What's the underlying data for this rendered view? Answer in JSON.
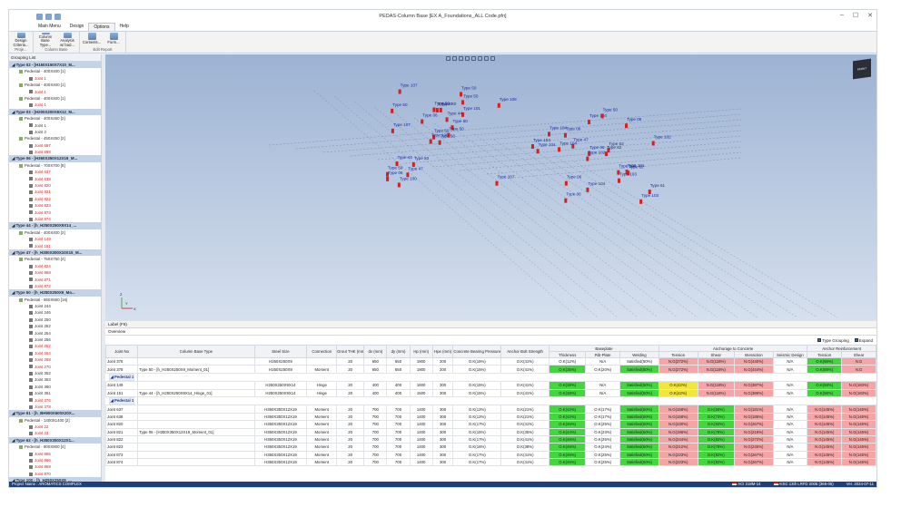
{
  "app": {
    "title": "PEDAS-Column Base [EX A_Foundations_ALL Code.pfn]"
  },
  "menu": {
    "items": [
      "Main Menu",
      "Design",
      "Options",
      "Help"
    ],
    "active": "Options"
  },
  "ribbon": {
    "groups": [
      {
        "label": "Proje...",
        "buttons": [
          "Design Criteria..."
        ]
      },
      {
        "label": "Column Base",
        "buttons": [
          "Column Base Type...",
          "Analysis w/ bad..."
        ]
      },
      {
        "label": "Edit Report",
        "buttons": [
          "Contents...",
          "Form..."
        ]
      }
    ]
  },
  "grouping": {
    "header": "Grouping List",
    "items": [
      {
        "kind": "type",
        "text": "Type 02 - [H150X150X7X10_M..."
      },
      {
        "kind": "ped",
        "text": "Pedestal - 400X400 [1]"
      },
      {
        "kind": "joint",
        "text": "Joint 1",
        "red": true
      },
      {
        "kind": "ped",
        "text": "Pedestal - 400X400 [1]"
      },
      {
        "kind": "joint",
        "text": "Joint 1",
        "red": true
      },
      {
        "kind": "ped",
        "text": "Pedestal - 400X400 [1]"
      },
      {
        "kind": "joint",
        "text": "Joint 1",
        "red": true
      },
      {
        "kind": "type",
        "text": "Type 03 - [H200X200X8X12_M..."
      },
      {
        "kind": "ped",
        "text": "Pedestal - 400X450 [2]"
      },
      {
        "kind": "joint",
        "text": "Joint 1",
        "red": false
      },
      {
        "kind": "joint",
        "text": "Joint 2",
        "red": false
      },
      {
        "kind": "ped",
        "text": "Pedestal - 450X450 [2]"
      },
      {
        "kind": "joint",
        "text": "Joint 697",
        "red": true
      },
      {
        "kind": "joint",
        "text": "Joint 698",
        "red": true
      },
      {
        "kind": "type",
        "text": "Type 06 - [H350X350X12X19_M..."
      },
      {
        "kind": "ped",
        "text": "Pedestal - 700X700 [8]"
      },
      {
        "kind": "joint",
        "text": "Joint 637",
        "red": true
      },
      {
        "kind": "joint",
        "text": "Joint 638",
        "red": true
      },
      {
        "kind": "joint",
        "text": "Joint 820",
        "red": true
      },
      {
        "kind": "joint",
        "text": "Joint 821",
        "red": true
      },
      {
        "kind": "joint",
        "text": "Joint 822",
        "red": true
      },
      {
        "kind": "joint",
        "text": "Joint 823",
        "red": true
      },
      {
        "kind": "joint",
        "text": "Joint 873",
        "red": true
      },
      {
        "kind": "joint",
        "text": "Joint 874",
        "red": true
      },
      {
        "kind": "type",
        "text": "Type 44 - [h_H250X250X9X14_..."
      },
      {
        "kind": "ped",
        "text": "Pedestal - 400X400 [2]"
      },
      {
        "kind": "joint",
        "text": "Joint 149",
        "red": true
      },
      {
        "kind": "joint",
        "text": "Joint 151",
        "red": true
      },
      {
        "kind": "type",
        "text": "Type 47 - [h_H300X300X10X15_M..."
      },
      {
        "kind": "ped",
        "text": "Pedestal - 750X750 [4]"
      },
      {
        "kind": "joint",
        "text": "Joint 824",
        "red": true
      },
      {
        "kind": "joint",
        "text": "Joint 868",
        "red": true
      },
      {
        "kind": "joint",
        "text": "Joint 871",
        "red": true
      },
      {
        "kind": "joint",
        "text": "Joint 872",
        "red": true
      },
      {
        "kind": "type",
        "text": "Type 50 - [h_H250X250X9_Mo..."
      },
      {
        "kind": "ped",
        "text": "Pedestal - 650X650 [16]"
      },
      {
        "kind": "joint",
        "text": "Joint 244",
        "red": false
      },
      {
        "kind": "joint",
        "text": "Joint 246",
        "red": false
      },
      {
        "kind": "joint",
        "text": "Joint 250",
        "red": false
      },
      {
        "kind": "joint",
        "text": "Joint 252",
        "red": false
      },
      {
        "kind": "joint",
        "text": "Joint 254",
        "red": false
      },
      {
        "kind": "joint",
        "text": "Joint 256",
        "red": false
      },
      {
        "kind": "joint",
        "text": "Joint 262",
        "red": true
      },
      {
        "kind": "joint",
        "text": "Joint 264",
        "red": true
      },
      {
        "kind": "joint",
        "text": "Joint 268",
        "red": true
      },
      {
        "kind": "joint",
        "text": "Joint 270",
        "red": true
      },
      {
        "kind": "joint",
        "text": "Joint 352",
        "red": false
      },
      {
        "kind": "joint",
        "text": "Joint 353",
        "red": false
      },
      {
        "kind": "joint",
        "text": "Joint 360",
        "red": false
      },
      {
        "kind": "joint",
        "text": "Joint 361",
        "red": false
      },
      {
        "kind": "joint",
        "text": "Joint 376",
        "red": true
      },
      {
        "kind": "joint",
        "text": "Joint 378",
        "red": true
      },
      {
        "kind": "type",
        "text": "Type 61 - [h_BH900X600X20X..."
      },
      {
        "kind": "ped",
        "text": "Pedestal - 1400X1400 [2]"
      },
      {
        "kind": "joint",
        "text": "Joint 22",
        "red": true
      },
      {
        "kind": "joint",
        "text": "Joint 23",
        "red": true
      },
      {
        "kind": "type",
        "text": "Type 62 - [h_H350X350X12X1..."
      },
      {
        "kind": "ped",
        "text": "Pedestal - 800X800 [4]"
      },
      {
        "kind": "joint",
        "text": "Joint 865",
        "red": true
      },
      {
        "kind": "joint",
        "text": "Joint 866",
        "red": true
      },
      {
        "kind": "joint",
        "text": "Joint 869",
        "red": true
      },
      {
        "kind": "joint",
        "text": "Joint 870",
        "red": true
      },
      {
        "kind": "type",
        "text": "Type 100 - [h_H250X250X9_..."
      }
    ]
  },
  "view3d": {
    "label_bar": "Label (F6)",
    "cube_text": "FRONT",
    "axis_x": "X",
    "axis_y": "Y",
    "axis_z": "Z",
    "labels": [
      "Type 50",
      "Type 50",
      "Type 50",
      "Type 50",
      "Type 50",
      "Type 50",
      "Type 50",
      "Type 50",
      "Type 50",
      "Type 50",
      "Type 107",
      "Type 107",
      "Type 107",
      "Type 108",
      "Type 100",
      "Type 101",
      "Type 100",
      "Type 50",
      "Type 44",
      "Type 44",
      "Type 06",
      "Type 06",
      "Type 47",
      "Type 47",
      "Type 62",
      "Type 62",
      "Type 104",
      "Type 104",
      "Type 104",
      "Type 103",
      "Type 102",
      "Type 102",
      "Type 104",
      "Type 06",
      "Type 06",
      "Type 06",
      "Type 06",
      "Type 103",
      "Type 61",
      "Type 101",
      "Type 50",
      "Type 47",
      "Type 104",
      "Type 103",
      "Type 06",
      "Type 104",
      "Type 62"
    ]
  },
  "overview": {
    "header": "Overview",
    "opt_type_grouping": "Type Grouping",
    "opt_expand": "Expand",
    "head_groups": [
      "Concrete Bearing Pressure",
      "Anchor Bolt Strength",
      "Baseplate",
      "Anchorage to Concrete",
      "Anchor Reinforcement"
    ],
    "columns": [
      "Joint No",
      "Column Base Type",
      "Steel Size",
      "Connection",
      "Grout THK (mm)",
      "dx (mm)",
      "dy (mm)",
      "Hp (mm)",
      "Hpe (mm)",
      "Concrete Bearing Pressure",
      "Anchor Bolt Strength",
      "Thickness",
      "Rib-Plate",
      "Welding",
      "Tension",
      "Shear",
      "Interaction",
      "Seismic Design",
      "Tension",
      "Shear"
    ],
    "rows": [
      {
        "g": false,
        "cells": [
          "Joint 376",
          "",
          "H250X250X9",
          "",
          "20",
          "650",
          "650",
          "1900",
          "200",
          "O.K(15%)",
          "O.K(41%)",
          "O.K(12%)",
          "N/A",
          "Satisfied(50%)",
          "N.G(272%)",
          "N.G(118%)",
          "N.G(440%)",
          "N/A",
          "O.K(88%)",
          "N.G"
        ],
        "cls": [
          "",
          "",
          "",
          "",
          "",
          "",
          "",
          "",
          "",
          "",
          "",
          "",
          "",
          "",
          "r",
          "r",
          "r",
          "",
          "g",
          "r"
        ]
      },
      {
        "g": false,
        "cells": [
          "Joint 378",
          "Type 50 - [h_H250X250X9_Moment_01]",
          "H250X250X9",
          "Moment",
          "20",
          "650",
          "650",
          "1900",
          "200",
          "O.K(15%)",
          "O.K(41%)",
          "O.K(35%)",
          "O.K(20%)",
          "Satisfied(50%)",
          "N.G(272%)",
          "N.G(118%)",
          "N.G(444%)",
          "N/A",
          "O.K(88%)",
          "N.G"
        ],
        "cls": [
          "",
          "",
          "",
          "",
          "",
          "",
          "",
          "",
          "",
          "",
          "",
          "g",
          "",
          "g",
          "r",
          "r",
          "r",
          "",
          "g",
          "r"
        ]
      },
      {
        "g": true,
        "cells": [
          "◢ Pedestal 18 [400 x 400 x 1600 ] [ 2 - EA ]"
        ]
      },
      {
        "g": false,
        "cells": [
          "Joint 149",
          "",
          "H250X250X9X14",
          "Hinge",
          "20",
          "400",
          "400",
          "1600",
          "300",
          "O.K(15%)",
          "O.K(41%)",
          "O.K(38%)",
          "N/A",
          "Satisfied(50%)",
          "O.K(42%)",
          "N.G(118%)",
          "N.G(387%)",
          "N/A",
          "O.K(58%)",
          "N.G(183%)"
        ],
        "cls": [
          "",
          "",
          "",
          "",
          "",
          "",
          "",
          "",
          "",
          "",
          "",
          "g",
          "",
          "g",
          "y",
          "r",
          "r",
          "",
          "g",
          "r"
        ]
      },
      {
        "g": false,
        "cells": [
          "Joint 151",
          "Type 44 - [h_H250X250X9X14_Hinge_01]",
          "H250X250X9X14",
          "Hinge",
          "20",
          "400",
          "400",
          "1600",
          "300",
          "O.K(15%)",
          "O.K(41%)",
          "O.K(38%)",
          "N/A",
          "Satisfied(50%)",
          "O.K(42%)",
          "N.G(118%)",
          "N.G(389%)",
          "N/A",
          "O.K(58%)",
          "N.G(183%)"
        ],
        "cls": [
          "",
          "",
          "",
          "",
          "",
          "",
          "",
          "",
          "",
          "",
          "",
          "g",
          "",
          "g",
          "y",
          "r",
          "r",
          "",
          "g",
          "r"
        ]
      },
      {
        "g": true,
        "cells": [
          "◢ Pedestal 19 [700 x 700 x 1400 ] [ 8 - EA ]"
        ]
      },
      {
        "g": false,
        "cells": [
          "Joint 637",
          "",
          "H350X350X12X19",
          "Moment",
          "20",
          "700",
          "700",
          "1400",
          "300",
          "O.K(12%)",
          "O.K(21%)",
          "O.K(42%)",
          "O.K(17%)",
          "Satisfied(50%)",
          "N.G(158%)",
          "O.K(59%)",
          "N.G(181%)",
          "N/A",
          "N.G(145%)",
          "N.G(145%)"
        ],
        "cls": [
          "",
          "",
          "",
          "",
          "",
          "",
          "",
          "",
          "",
          "",
          "",
          "g",
          "",
          "g",
          "r",
          "g",
          "r",
          "",
          "r",
          "r"
        ]
      },
      {
        "g": false,
        "cells": [
          "Joint 638",
          "",
          "H350X350X12X19",
          "Moment",
          "20",
          "700",
          "700",
          "1400",
          "300",
          "O.K(12%)",
          "O.K(21%)",
          "O.K(42%)",
          "O.K(17%)",
          "Satisfied(50%)",
          "N.G(158%)",
          "O.K(73%)",
          "N.G(185%)",
          "N/A",
          "N.G(145%)",
          "N.G(145%)"
        ],
        "cls": [
          "",
          "",
          "",
          "",
          "",
          "",
          "",
          "",
          "",
          "",
          "",
          "g",
          "",
          "g",
          "r",
          "g",
          "r",
          "",
          "r",
          "r"
        ]
      },
      {
        "g": false,
        "cells": [
          "Joint 820",
          "",
          "H350X350X12X19",
          "Moment",
          "20",
          "700",
          "700",
          "1400",
          "300",
          "O.K(17%)",
          "O.K(41%)",
          "O.K(46%)",
          "O.K(25%)",
          "Satisfied(50%)",
          "N.G(230%)",
          "O.K(83%)",
          "N.G(267%)",
          "N/A",
          "N.G(145%)",
          "N.G(145%)"
        ],
        "cls": [
          "",
          "",
          "",
          "",
          "",
          "",
          "",
          "",
          "",
          "",
          "",
          "g",
          "",
          "g",
          "r",
          "g",
          "r",
          "",
          "r",
          "r"
        ]
      },
      {
        "g": false,
        "cells": [
          "Joint 821",
          "Type 06 - [H350X350X12X19_Moment_01]",
          "H350X350X12X19",
          "Moment",
          "20",
          "700",
          "700",
          "1400",
          "300",
          "O.K(15%)",
          "O.K(35%)",
          "O.K(44%)",
          "O.K(23%)",
          "Satisfied(50%)",
          "N.G(196%)",
          "O.K(78%)",
          "N.G(218%)",
          "N/A",
          "N.G(145%)",
          "N.G(145%)"
        ],
        "cls": [
          "",
          "",
          "",
          "",
          "",
          "",
          "",
          "",
          "",
          "",
          "",
          "g",
          "",
          "g",
          "r",
          "g",
          "r",
          "",
          "r",
          "r"
        ]
      },
      {
        "g": false,
        "cells": [
          "Joint 822",
          "",
          "H350X350X12X19",
          "Moment",
          "20",
          "700",
          "700",
          "1400",
          "300",
          "O.K(17%)",
          "O.K(41%)",
          "O.K(46%)",
          "O.K(25%)",
          "Satisfied(50%)",
          "N.G(244%)",
          "O.K(82%)",
          "N.G(272%)",
          "N/A",
          "N.G(145%)",
          "N.G(145%)"
        ],
        "cls": [
          "",
          "",
          "",
          "",
          "",
          "",
          "",
          "",
          "",
          "",
          "",
          "g",
          "",
          "g",
          "r",
          "g",
          "r",
          "",
          "r",
          "r"
        ]
      },
      {
        "g": false,
        "cells": [
          "Joint 823",
          "",
          "H350X350X12X19",
          "Moment",
          "20",
          "700",
          "700",
          "1400",
          "300",
          "O.K(16%)",
          "O.K(38%)",
          "O.K(45%)",
          "O.K(24%)",
          "Satisfied(50%)",
          "N.G(212%)",
          "O.K(79%)",
          "N.G(245%)",
          "N/A",
          "N.G(145%)",
          "N.G(145%)"
        ],
        "cls": [
          "",
          "",
          "",
          "",
          "",
          "",
          "",
          "",
          "",
          "",
          "",
          "g",
          "",
          "g",
          "r",
          "g",
          "r",
          "",
          "r",
          "r"
        ]
      },
      {
        "g": false,
        "cells": [
          "Joint 873",
          "",
          "H350X350X12X19",
          "Moment",
          "20",
          "700",
          "700",
          "1400",
          "300",
          "O.K(17%)",
          "O.K(41%)",
          "O.K(46%)",
          "O.K(25%)",
          "Satisfied(50%)",
          "N.G(223%)",
          "O.K(82%)",
          "N.G(267%)",
          "N/A",
          "N.G(145%)",
          "N.G(145%)"
        ],
        "cls": [
          "",
          "",
          "",
          "",
          "",
          "",
          "",
          "",
          "",
          "",
          "",
          "g",
          "",
          "g",
          "r",
          "g",
          "r",
          "",
          "r",
          "r"
        ]
      },
      {
        "g": false,
        "cells": [
          "Joint 874",
          "",
          "H350X350X12X19",
          "Moment",
          "20",
          "700",
          "700",
          "1400",
          "300",
          "O.K(17%)",
          "O.K(41%)",
          "O.K(46%)",
          "O.K(25%)",
          "Satisfied(50%)",
          "N.G(223%)",
          "O.K(82%)",
          "N.G(267%)",
          "N/A",
          "N.G(145%)",
          "N.G(145%)"
        ],
        "cls": [
          "",
          "",
          "",
          "",
          "",
          "",
          "",
          "",
          "",
          "",
          "",
          "g",
          "",
          "g",
          "r",
          "g",
          "r",
          "",
          "r",
          "r"
        ]
      }
    ]
  },
  "status": {
    "project": "Project Name : AROMATICS COMPLEX",
    "code1": "ACI 318M-14",
    "code2": "AISC 13th LRFD 2005 (366-05)",
    "version": "Ver. 2024-07-11"
  }
}
